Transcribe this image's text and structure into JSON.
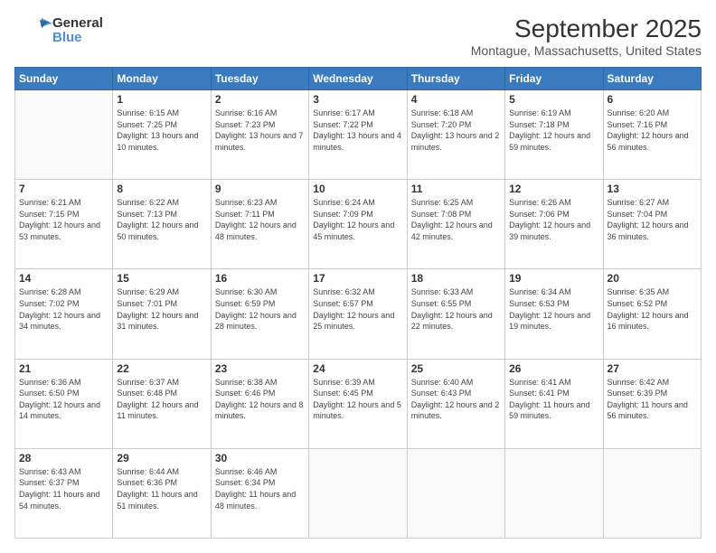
{
  "header": {
    "logo_general": "General",
    "logo_blue": "Blue",
    "month_title": "September 2025",
    "location": "Montague, Massachusetts, United States"
  },
  "days_of_week": [
    "Sunday",
    "Monday",
    "Tuesday",
    "Wednesday",
    "Thursday",
    "Friday",
    "Saturday"
  ],
  "weeks": [
    [
      {
        "day": "",
        "sunrise": "",
        "sunset": "",
        "daylight": ""
      },
      {
        "day": "1",
        "sunrise": "6:15 AM",
        "sunset": "7:25 PM",
        "daylight": "13 hours and 10 minutes."
      },
      {
        "day": "2",
        "sunrise": "6:16 AM",
        "sunset": "7:23 PM",
        "daylight": "13 hours and 7 minutes."
      },
      {
        "day": "3",
        "sunrise": "6:17 AM",
        "sunset": "7:22 PM",
        "daylight": "13 hours and 4 minutes."
      },
      {
        "day": "4",
        "sunrise": "6:18 AM",
        "sunset": "7:20 PM",
        "daylight": "13 hours and 2 minutes."
      },
      {
        "day": "5",
        "sunrise": "6:19 AM",
        "sunset": "7:18 PM",
        "daylight": "12 hours and 59 minutes."
      },
      {
        "day": "6",
        "sunrise": "6:20 AM",
        "sunset": "7:16 PM",
        "daylight": "12 hours and 56 minutes."
      }
    ],
    [
      {
        "day": "7",
        "sunrise": "6:21 AM",
        "sunset": "7:15 PM",
        "daylight": "12 hours and 53 minutes."
      },
      {
        "day": "8",
        "sunrise": "6:22 AM",
        "sunset": "7:13 PM",
        "daylight": "12 hours and 50 minutes."
      },
      {
        "day": "9",
        "sunrise": "6:23 AM",
        "sunset": "7:11 PM",
        "daylight": "12 hours and 48 minutes."
      },
      {
        "day": "10",
        "sunrise": "6:24 AM",
        "sunset": "7:09 PM",
        "daylight": "12 hours and 45 minutes."
      },
      {
        "day": "11",
        "sunrise": "6:25 AM",
        "sunset": "7:08 PM",
        "daylight": "12 hours and 42 minutes."
      },
      {
        "day": "12",
        "sunrise": "6:26 AM",
        "sunset": "7:06 PM",
        "daylight": "12 hours and 39 minutes."
      },
      {
        "day": "13",
        "sunrise": "6:27 AM",
        "sunset": "7:04 PM",
        "daylight": "12 hours and 36 minutes."
      }
    ],
    [
      {
        "day": "14",
        "sunrise": "6:28 AM",
        "sunset": "7:02 PM",
        "daylight": "12 hours and 34 minutes."
      },
      {
        "day": "15",
        "sunrise": "6:29 AM",
        "sunset": "7:01 PM",
        "daylight": "12 hours and 31 minutes."
      },
      {
        "day": "16",
        "sunrise": "6:30 AM",
        "sunset": "6:59 PM",
        "daylight": "12 hours and 28 minutes."
      },
      {
        "day": "17",
        "sunrise": "6:32 AM",
        "sunset": "6:57 PM",
        "daylight": "12 hours and 25 minutes."
      },
      {
        "day": "18",
        "sunrise": "6:33 AM",
        "sunset": "6:55 PM",
        "daylight": "12 hours and 22 minutes."
      },
      {
        "day": "19",
        "sunrise": "6:34 AM",
        "sunset": "6:53 PM",
        "daylight": "12 hours and 19 minutes."
      },
      {
        "day": "20",
        "sunrise": "6:35 AM",
        "sunset": "6:52 PM",
        "daylight": "12 hours and 16 minutes."
      }
    ],
    [
      {
        "day": "21",
        "sunrise": "6:36 AM",
        "sunset": "6:50 PM",
        "daylight": "12 hours and 14 minutes."
      },
      {
        "day": "22",
        "sunrise": "6:37 AM",
        "sunset": "6:48 PM",
        "daylight": "12 hours and 11 minutes."
      },
      {
        "day": "23",
        "sunrise": "6:38 AM",
        "sunset": "6:46 PM",
        "daylight": "12 hours and 8 minutes."
      },
      {
        "day": "24",
        "sunrise": "6:39 AM",
        "sunset": "6:45 PM",
        "daylight": "12 hours and 5 minutes."
      },
      {
        "day": "25",
        "sunrise": "6:40 AM",
        "sunset": "6:43 PM",
        "daylight": "12 hours and 2 minutes."
      },
      {
        "day": "26",
        "sunrise": "6:41 AM",
        "sunset": "6:41 PM",
        "daylight": "11 hours and 59 minutes."
      },
      {
        "day": "27",
        "sunrise": "6:42 AM",
        "sunset": "6:39 PM",
        "daylight": "11 hours and 56 minutes."
      }
    ],
    [
      {
        "day": "28",
        "sunrise": "6:43 AM",
        "sunset": "6:37 PM",
        "daylight": "11 hours and 54 minutes."
      },
      {
        "day": "29",
        "sunrise": "6:44 AM",
        "sunset": "6:36 PM",
        "daylight": "11 hours and 51 minutes."
      },
      {
        "day": "30",
        "sunrise": "6:46 AM",
        "sunset": "6:34 PM",
        "daylight": "11 hours and 48 minutes."
      },
      {
        "day": "",
        "sunrise": "",
        "sunset": "",
        "daylight": ""
      },
      {
        "day": "",
        "sunrise": "",
        "sunset": "",
        "daylight": ""
      },
      {
        "day": "",
        "sunrise": "",
        "sunset": "",
        "daylight": ""
      },
      {
        "day": "",
        "sunrise": "",
        "sunset": "",
        "daylight": ""
      }
    ]
  ]
}
